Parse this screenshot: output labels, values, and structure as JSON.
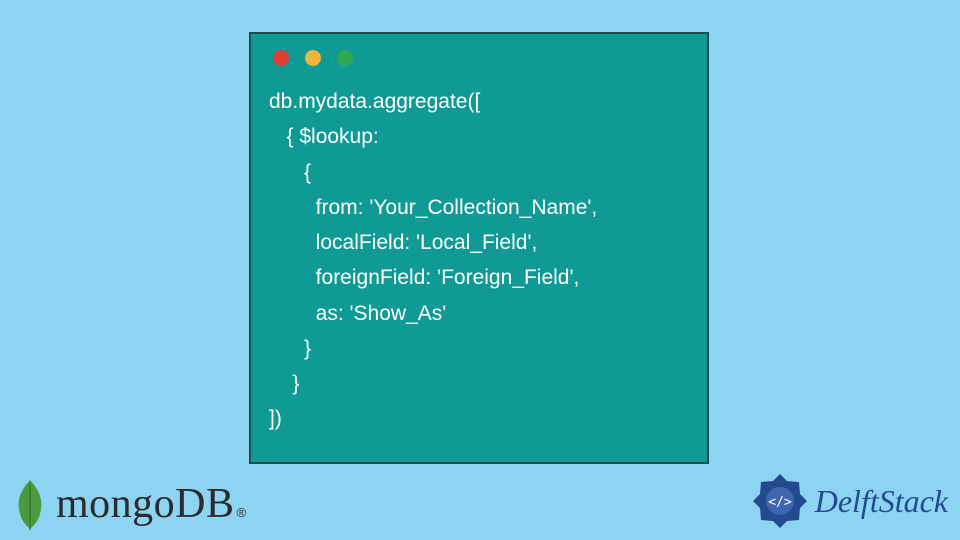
{
  "code": {
    "lines": [
      "db.mydata.aggregate([",
      "   { $lookup:",
      "      {",
      "        from: 'Your_Collection_Name',",
      "        localField: 'Local_Field',",
      "        foreignField: 'Foreign_Field',",
      "        as: 'Show_As'",
      "      }",
      "    }",
      "])"
    ]
  },
  "traffic": {
    "red": "#de3f34",
    "yellow": "#f0b63b",
    "green": "#2fa84f"
  },
  "logos": {
    "mongo": {
      "text": "mongoDB",
      "reg": "®"
    },
    "delft": {
      "text": "DelftStack"
    }
  },
  "colors": {
    "bg": "#8dd4f2",
    "card": "#0f9a96",
    "cardBorder": "#184f4b",
    "codeText": "#ffffff",
    "mongoLeaf": "#4a9b3f",
    "delftBlue": "#234a8f"
  }
}
